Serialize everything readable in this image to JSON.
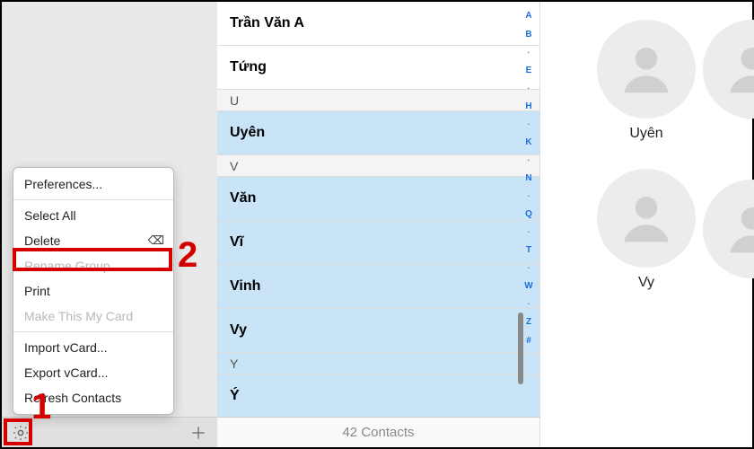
{
  "contacts": {
    "countLabel": "42 Contacts",
    "rows": [
      {
        "type": "row",
        "name": "Trần Văn A",
        "selected": false
      },
      {
        "type": "row",
        "name": "Tứng",
        "selected": false
      },
      {
        "type": "section",
        "letter": "U",
        "selected": false
      },
      {
        "type": "row",
        "name": "Uyên",
        "selected": true
      },
      {
        "type": "section",
        "letter": "V",
        "selected": false
      },
      {
        "type": "row",
        "name": "Văn",
        "selected": true
      },
      {
        "type": "row",
        "name": "Vĩ",
        "selected": true
      },
      {
        "type": "row",
        "name": "Vinh",
        "selected": true
      },
      {
        "type": "row",
        "name": "Vy",
        "selected": true
      },
      {
        "type": "section",
        "letter": "Y",
        "selected": true
      },
      {
        "type": "row",
        "name": "Ý",
        "selected": true
      }
    ],
    "indexLetters": [
      "A",
      "B",
      "·",
      "E",
      "·",
      "H",
      "·",
      "K",
      "·",
      "N",
      "·",
      "Q",
      "·",
      "T",
      "·",
      "W",
      "·",
      "Z",
      "#"
    ]
  },
  "detail": {
    "card1": "Uyên",
    "card2": "Vy"
  },
  "menu": {
    "preferences": "Preferences...",
    "selectAll": "Select All",
    "delete": "Delete",
    "deleteShortcut": "⌫",
    "renameGroup": "Rename Group",
    "print": "Print",
    "makeMyCard": "Make This My Card",
    "importVcard": "Import vCard...",
    "exportVcard": "Export vCard...",
    "refresh": "Refresh Contacts"
  },
  "callouts": {
    "one": "1",
    "two": "2"
  }
}
